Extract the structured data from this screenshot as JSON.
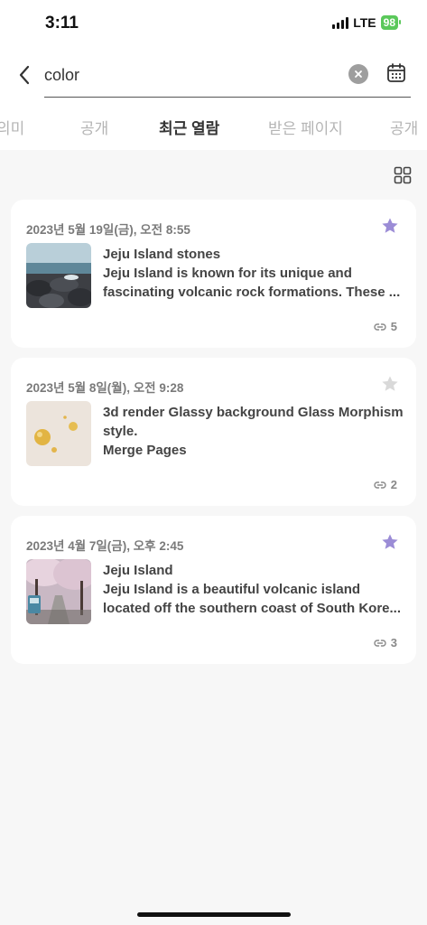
{
  "status_bar": {
    "time": "3:11",
    "network": "LTE",
    "battery": "98"
  },
  "search": {
    "value": "color",
    "placeholder": ""
  },
  "tabs": [
    {
      "label": "의미",
      "active": false
    },
    {
      "label": "공개",
      "active": false
    },
    {
      "label": "최근 열람",
      "active": true
    },
    {
      "label": "받은 페이지",
      "active": false
    },
    {
      "label": "공개",
      "active": false
    }
  ],
  "colors": {
    "star_active": "#9b8cd6",
    "star_inactive": "#d9d9d9",
    "battery": "#5ac85a"
  },
  "cards": [
    {
      "date": "2023년 5월 19일(금), 오전 8:55",
      "starred": true,
      "title": "Jeju Island stones",
      "description": "Jeju Island is known for its unique and fascinating volcanic rock formations. These ...",
      "link_count": "5",
      "thumb_icon": "rocky-coast-image"
    },
    {
      "date": "2023년 5월 8일(월), 오전 9:28",
      "starred": false,
      "title": "3d render Glassy background Glass Morphism style.",
      "description": "Merge Pages",
      "link_count": "2",
      "thumb_icon": "glass-spheres-image"
    },
    {
      "date": "2023년 4월 7일(금), 오후 2:45",
      "starred": true,
      "title": "Jeju Island",
      "description": "Jeju Island is a beautiful volcanic island located off the southern coast of South Kore...",
      "link_count": "3",
      "thumb_icon": "cherry-blossom-road-image"
    }
  ]
}
